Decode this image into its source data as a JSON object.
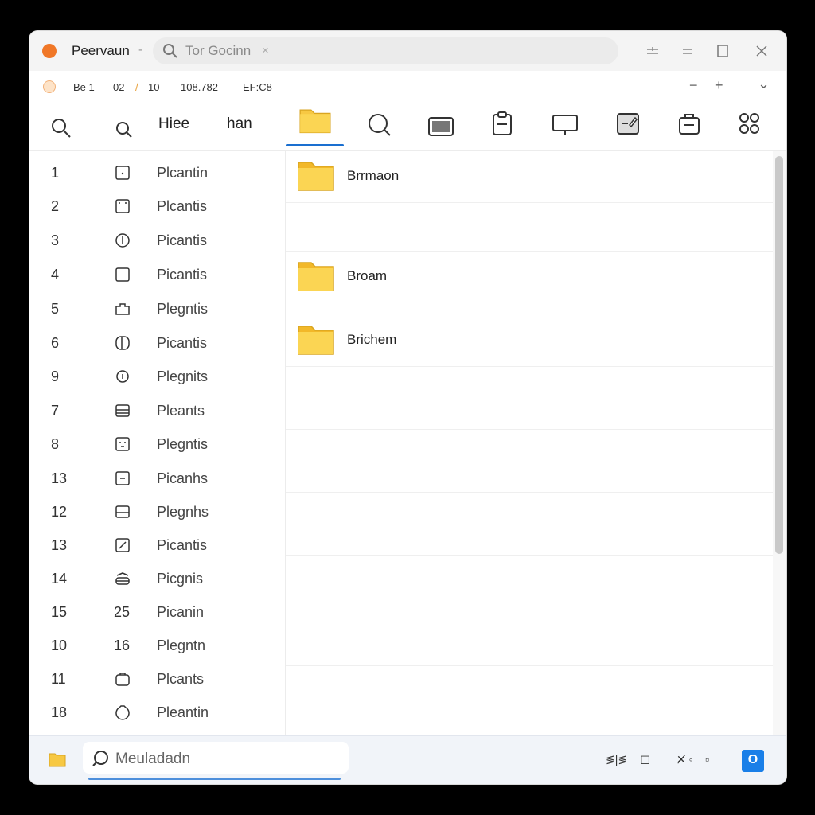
{
  "window": {
    "title": "Peervaun",
    "title_separator": "-",
    "search_text": "Tor Gocinn",
    "search_clear": "×"
  },
  "info_bar": {
    "items": [
      "Be 1",
      "02",
      "10",
      "108.782",
      "EF:C8"
    ],
    "separator": "/",
    "controls": [
      "−",
      "+",
      "⌄"
    ]
  },
  "toolbar": {
    "labels": [
      "Hiee",
      "han"
    ],
    "icons": [
      "search-icon",
      "search-small-icon",
      "folder-icon",
      "magnify-icon",
      "window-icon",
      "clipboard-icon",
      "monitor-icon",
      "edit-icon",
      "briefcase-icon",
      "apps-icon"
    ],
    "active": "folder-icon"
  },
  "left_list": [
    {
      "num": "1",
      "icon": "square-dot-icon",
      "label": "Plcantin"
    },
    {
      "num": "2",
      "icon": "window-dots-icon",
      "label": "Plcantis"
    },
    {
      "num": "3",
      "icon": "info-circle-icon",
      "label": "Picantis"
    },
    {
      "num": "4",
      "icon": "square-icon",
      "label": "Picantis"
    },
    {
      "num": "5",
      "icon": "tray-icon",
      "label": "Plegntis"
    },
    {
      "num": "6",
      "icon": "split-icon",
      "label": "Picantis"
    },
    {
      "num": "9",
      "icon": "circle-tag-icon",
      "label": "Plegnits"
    },
    {
      "num": "7",
      "icon": "list-box-icon",
      "label": "Pleants"
    },
    {
      "num": "8",
      "icon": "face-box-icon",
      "label": "Plegntis"
    },
    {
      "num": "13",
      "icon": "minus-box-icon",
      "label": "Picanhs"
    },
    {
      "num": "12",
      "icon": "bar-box-icon",
      "label": "Plegnhs"
    },
    {
      "num": "13",
      "icon": "slash-box-icon",
      "label": "Picantis"
    },
    {
      "num": "14",
      "icon": "stack-icon",
      "label": "Picgnis"
    },
    {
      "num": "15",
      "icon_text": "25",
      "label": "Picanin"
    },
    {
      "num": "10",
      "icon_text": "16",
      "label": "Plegntn"
    },
    {
      "num": "11",
      "icon": "bag-icon",
      "label": "Plcants"
    },
    {
      "num": "18",
      "icon": "circle-icon",
      "label": "Pleantin"
    }
  ],
  "folders": [
    {
      "name": "Brrmaon"
    },
    {
      "name": "Broam"
    },
    {
      "name": "Brichem"
    }
  ],
  "bottom_bar": {
    "search_text": "Meuladadn",
    "item_a": "≶|≶",
    "item_b": "◻",
    "item_c": "✕̸ ◦",
    "item_d": "▫",
    "badge": "O"
  },
  "colors": {
    "accent": "#1a6fd0",
    "folder": "#f7c843",
    "app_dot": "#f07727"
  }
}
